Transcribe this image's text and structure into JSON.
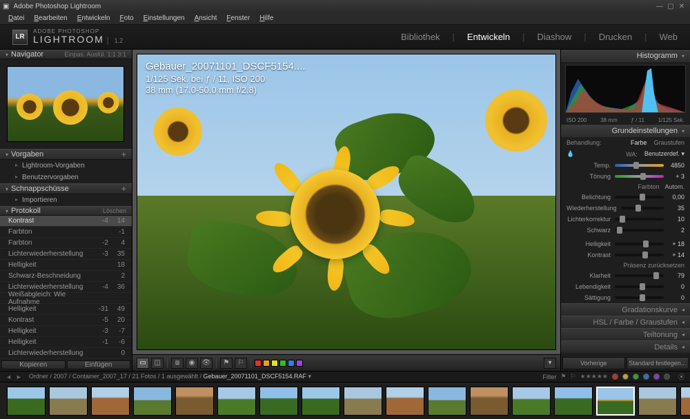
{
  "app": {
    "title": "Adobe Photoshop Lightroom",
    "logo": "LR",
    "brand1": "ADOBE PHOTOSHOP",
    "brand2": "LIGHTROOM",
    "version": "1.2"
  },
  "menu": [
    "Datei",
    "Bearbeiten",
    "Entwickeln",
    "Foto",
    "Einstellungen",
    "Ansicht",
    "Fenster",
    "Hilfe"
  ],
  "modules": {
    "items": [
      "Bibliothek",
      "Entwickeln",
      "Diashow",
      "Drucken",
      "Web"
    ],
    "active": "Entwickeln"
  },
  "navigator": {
    "title": "Navigator",
    "opts": "Einpas.  Ausfül.  1:1  3:1"
  },
  "vorgaben": {
    "title": "Vorgaben",
    "items": [
      "Lightroom-Vorgaben",
      "Benutzervorgaben"
    ]
  },
  "schnapp": {
    "title": "Schnappschüsse",
    "items": [
      "Importieren"
    ]
  },
  "protokoll": {
    "title": "Protokoll",
    "clear": "Löschen",
    "rows": [
      {
        "n": "Kontrast",
        "a": "-4",
        "b": "14",
        "hl": true
      },
      {
        "n": "Farbton",
        "a": "",
        "b": "-1"
      },
      {
        "n": "Farbton",
        "a": "-2",
        "b": "4"
      },
      {
        "n": "Lichterwiederherstellung",
        "a": "-3",
        "b": "35"
      },
      {
        "n": "Helligkeit",
        "a": "",
        "b": "18"
      },
      {
        "n": "Schwarz-Beschneidung",
        "a": "",
        "b": "2"
      },
      {
        "n": "Lichterwiederherstellung",
        "a": "-4",
        "b": "36"
      },
      {
        "n": "Weißabgleich: Wie Aufnahme",
        "a": "",
        "b": ""
      },
      {
        "n": "Helligkeit",
        "a": "-31",
        "b": "49"
      },
      {
        "n": "Kontrast",
        "a": "-5",
        "b": "20"
      },
      {
        "n": "Helligkeit",
        "a": "-3",
        "b": "-7"
      },
      {
        "n": "Helligkeit",
        "a": "-1",
        "b": "-6"
      },
      {
        "n": "Lichterwiederherstellung",
        "a": "",
        "b": "0"
      }
    ]
  },
  "leftbtns": {
    "copy": "Kopieren",
    "paste": "Einfügen"
  },
  "photo": {
    "filename": "Gebauer_20071101_DSCF5154....",
    "line2": "1/125 Sek. bei ƒ / 11, ISO 200",
    "line3": "38 mm (17.0-50.0 mm f/2.8)"
  },
  "centerToolbar": {
    "colors": [
      "#e03030",
      "#e0a020",
      "#e0e020",
      "#30c030",
      "#3080e0",
      "#a040e0"
    ]
  },
  "histogram": {
    "title": "Histogramm",
    "iso": "ISO 200",
    "fl": "38 mm",
    "ap": "ƒ / 11",
    "ss": "1/125 Sek."
  },
  "basic": {
    "title": "Grundeinstellungen",
    "behandlung": "Behandlung:",
    "farbe": "Farbe",
    "grau": "Graustufen",
    "wa": "WA:",
    "wa_val": "Benutzerdef.",
    "temp_lbl": "Temp.",
    "temp_val": "4850",
    "tint_lbl": "Tönung",
    "tint_val": "+ 3",
    "farbton": "Farbton",
    "autom": "Autom.",
    "rows": [
      {
        "l": "Belichtung",
        "v": "0,00",
        "p": 50
      },
      {
        "l": "Wiederherstellung",
        "v": "35",
        "p": 35
      },
      {
        "l": "Lichterkorrektur",
        "v": "10",
        "p": 10
      },
      {
        "l": "Schwarz",
        "v": "2",
        "p": 4
      }
    ],
    "rows2": [
      {
        "l": "Helligkeit",
        "v": "+ 18",
        "p": 58
      },
      {
        "l": "Kontrast",
        "v": "+ 14",
        "p": 56
      }
    ],
    "presenz": "Präsenz zurücksetzen",
    "rows3": [
      {
        "l": "Klarheit",
        "v": "79",
        "p": 79
      },
      {
        "l": "Lebendigkeit",
        "v": "0",
        "p": 50
      },
      {
        "l": "Sättigung",
        "v": "0",
        "p": 50
      }
    ]
  },
  "collapsed": [
    "Gradationskurve",
    "HSL  /  Farbe  /  Graustufen",
    "Teiltonung",
    "Details"
  ],
  "rightbtns": {
    "prev": "Vorherige",
    "reset": "Standard festlegen..."
  },
  "crumb": {
    "path": "Ordner / 2007 / Container_2007_17 / 21 Fotos / 1 ausgewählt /",
    "file": "Gebauer_20071101_DSCF5154.RAF",
    "filter": "Filter"
  },
  "filmstrip": {
    "count": 17,
    "selected": 14
  }
}
